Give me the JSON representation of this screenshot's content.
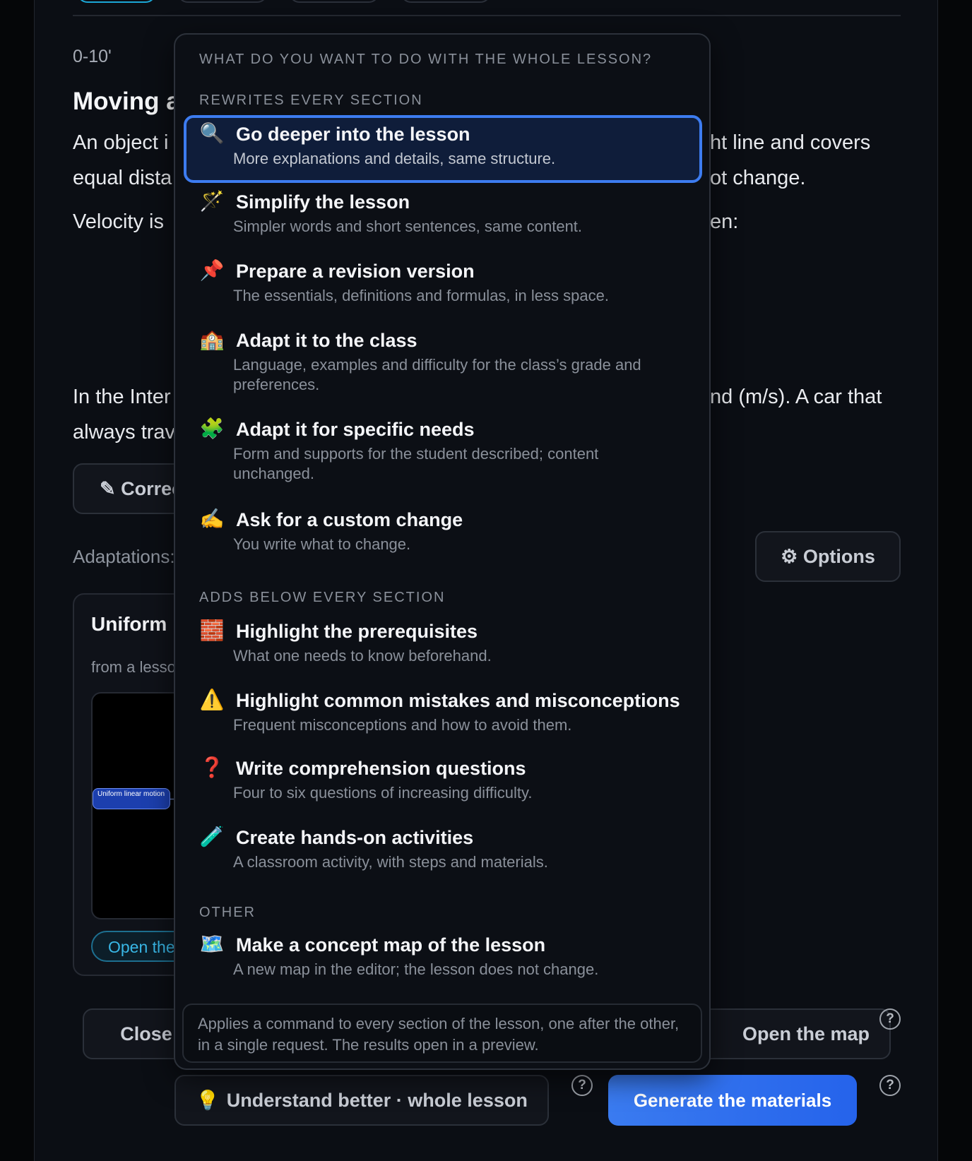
{
  "lesson": {
    "time": "0-10'",
    "section_title": "Moving a",
    "para1_line1_left": "An object i",
    "para1_line1_right": "ht line and covers",
    "para1_line2_left": "equal dista",
    "para1_line2_right": "ot change.",
    "para2_left": "Velocity is",
    "para2_right": "en:",
    "para3_line1_left": "In the Inter",
    "para3_line1_right": "nd (m/s). A car that",
    "para3_line2_left": "always trav",
    "correct_button": "✎ Correc",
    "adaptations_label": "Adaptations:",
    "options_button": "⚙ Options"
  },
  "card": {
    "title": "Uniform l",
    "subtitle": "from a lesso",
    "map_node": "Uniform linear motion",
    "open_link": "Open the"
  },
  "footer": {
    "close": "Close",
    "open_map": "Open the map",
    "understand": "Understand better · whole lesson",
    "generate": "Generate the materials",
    "help": "?"
  },
  "dropdown": {
    "heading": "WHAT DO YOU WANT TO DO WITH THE WHOLE LESSON?",
    "groups": {
      "rewrites": "REWRITES EVERY SECTION",
      "adds": "ADDS BELOW EVERY SECTION",
      "other": "OTHER"
    },
    "items": [
      {
        "icon": "🔍",
        "title": "Go deeper into the lesson",
        "desc": "More explanations and details, same structure."
      },
      {
        "icon": "🪄",
        "title": "Simplify the lesson",
        "desc": "Simpler words and short sentences, same content."
      },
      {
        "icon": "📌",
        "title": "Prepare a revision version",
        "desc": "The essentials, definitions and formulas, in less space."
      },
      {
        "icon": "🏫",
        "title": "Adapt it to the class",
        "desc": "Language, examples and difficulty for the class’s grade and preferences."
      },
      {
        "icon": "🧩",
        "title": "Adapt it for specific needs",
        "desc": "Form and supports for the student described; content unchanged."
      },
      {
        "icon": "✍️",
        "title": "Ask for a custom change",
        "desc": "You write what to change."
      },
      {
        "icon": "🧱",
        "title": "Highlight the prerequisites",
        "desc": "What one needs to know beforehand."
      },
      {
        "icon": "⚠️",
        "title": "Highlight common mistakes and misconceptions",
        "desc": "Frequent misconceptions and how to avoid them."
      },
      {
        "icon": "❓",
        "title": "Write comprehension questions",
        "desc": "Four to six questions of increasing difficulty."
      },
      {
        "icon": "🧪",
        "title": "Create hands-on activities",
        "desc": "A classroom activity, with steps and materials."
      },
      {
        "icon": "🗺️",
        "title": "Make a concept map of the lesson",
        "desc": "A new map in the editor; the lesson does not change."
      }
    ],
    "footer_note": "Applies a command to every section of the lesson, one after the other, in a single request. The results open in a preview.",
    "bulb_icon": "💡",
    "selected_index": 0
  },
  "colors": {
    "accent": "#3d7cf0",
    "primary_button": "#2563eb",
    "link": "#39b7e6"
  }
}
